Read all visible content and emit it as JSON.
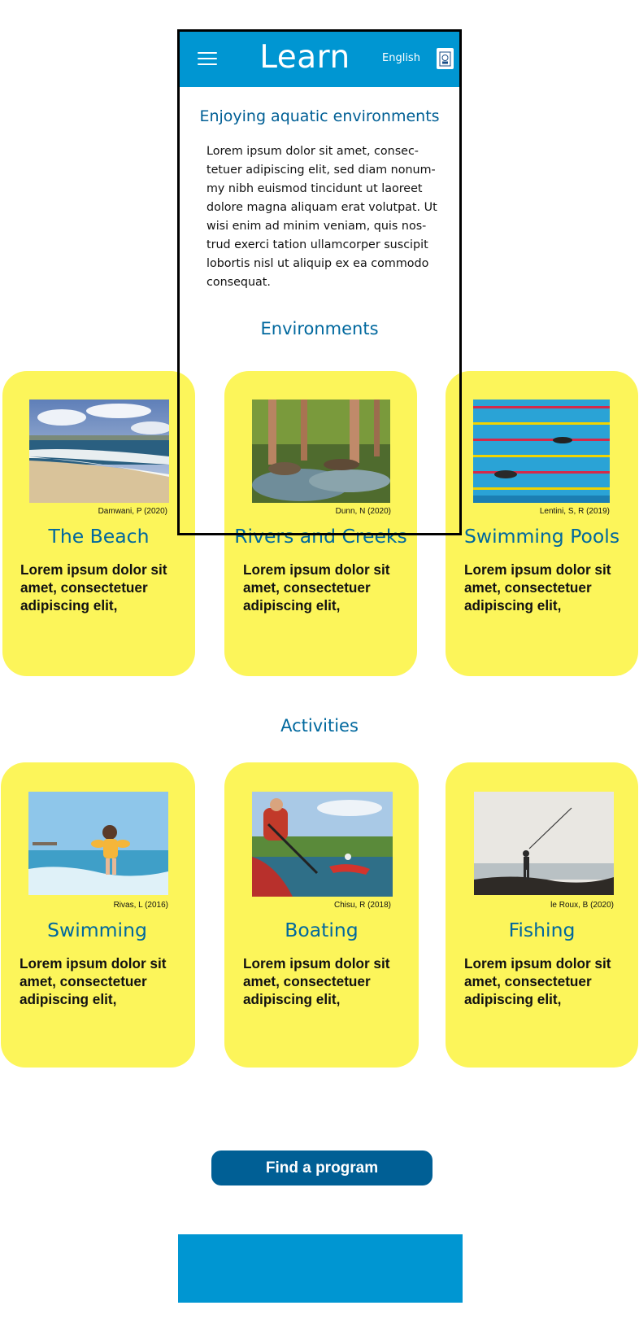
{
  "header": {
    "title": "Learn",
    "language": "English",
    "brand_color": "#0096d2",
    "menu_icon": "hamburger-icon",
    "logo_icon": "crest-icon"
  },
  "intro": {
    "heading": "Enjoying aquatic environments",
    "lines": [
      "Lorem ipsum dolor sit amet, consec-",
      "tetuer adipiscing elit, sed diam nonum-",
      "my nibh euismod tincidunt ut laoreet",
      "dolore magna aliquam erat volutpat. Ut",
      "wisi enim ad minim veniam, quis nos-",
      "trud exerci tation ullamcorper suscipit",
      "lobortis nisl ut aliquip ex ea commodo",
      "consequat."
    ]
  },
  "environments": {
    "title": "Environments",
    "cards": [
      {
        "title": "The Beach",
        "credit": "Damwani, P (2020)",
        "body": [
          "Lorem ipsum dolor sit",
          "amet, consectetuer",
          "adipiscing elit,"
        ]
      },
      {
        "title": "Rivers and Creeks",
        "credit": "Dunn, N (2020)",
        "body": [
          "Lorem ipsum dolor sit",
          "amet, consectetuer",
          "adipiscing elit,"
        ]
      },
      {
        "title": "Swimming Pools",
        "credit": "Lentini, S, R (2019)",
        "body": [
          "Lorem ipsum dolor sit",
          "amet, consectetuer",
          "adipiscing elit,"
        ]
      }
    ]
  },
  "activities": {
    "title": "Activities",
    "cards": [
      {
        "title": "Swimming",
        "credit": "Rivas, L (2016)",
        "body": [
          "Lorem ipsum dolor sit",
          "amet, consectetuer",
          "adipiscing elit,"
        ]
      },
      {
        "title": "Boating",
        "credit": "Chisu, R (2018)",
        "body": [
          "Lorem ipsum dolor sit",
          "amet, consectetuer",
          "adipiscing elit,"
        ]
      },
      {
        "title": "Fishing",
        "credit": "le Roux, B (2020)",
        "body": [
          "Lorem ipsum dolor sit",
          "amet, consectetuer",
          "adipiscing elit,"
        ]
      }
    ]
  },
  "cta": {
    "label": "Find a program"
  },
  "colors": {
    "card": "#fcf55a",
    "heading": "#00689e",
    "button": "#005f95"
  }
}
